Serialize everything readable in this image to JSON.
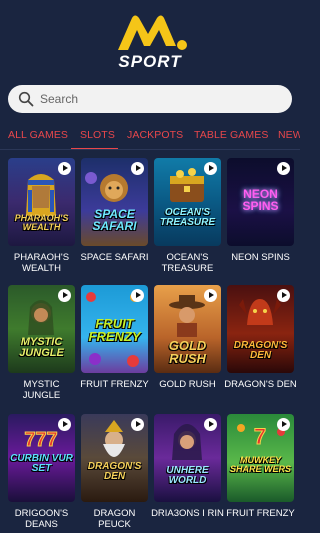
{
  "brand": {
    "sport_text": "SPORT"
  },
  "search": {
    "placeholder": "Search"
  },
  "tabs": [
    {
      "label": "ALL GAMES"
    },
    {
      "label": "SLOTS"
    },
    {
      "label": "JACKPOTS"
    },
    {
      "label": "TABLE GAMES"
    },
    {
      "label": "NEW"
    }
  ],
  "active_tab": "SLOTS",
  "colors": {
    "background": "#1a2540",
    "accent": "#e8474b",
    "logo_yellow": "#f5c518"
  },
  "games": [
    {
      "title": "PHARAOH'S WEALTH",
      "art_text": "PHARAOH'S WEALTH",
      "icon": "play-icon"
    },
    {
      "title": "SPACE SAFARI",
      "art_text": "SPACE SAFARI",
      "icon": "play-icon"
    },
    {
      "title": "OCEAN'S TREASURE",
      "art_text": "OCEAN'S TREASURE",
      "icon": "play-icon"
    },
    {
      "title": "NEON SPINS",
      "art_text": "NEON SPINS",
      "icon": "play-icon"
    },
    {
      "title": "MYSTIC JUNGLE",
      "art_text": "MYSTIC JUNGLE",
      "icon": "play-icon"
    },
    {
      "title": "FRUIT FRENZY",
      "art_text": "FRUIT FRENZY",
      "icon": "play-icon"
    },
    {
      "title": "GOLD RUSH",
      "art_text": "GOLD RUSH",
      "icon": "play-icon"
    },
    {
      "title": "DRAGON'S DEN",
      "art_text": "DRAGON'S DEN",
      "icon": "play-icon"
    },
    {
      "title": "DRIGOON'S DEANS",
      "art_text": "CURBIN VUR SET",
      "icon": "play-icon"
    },
    {
      "title": "DRAGON PEUCK",
      "art_text": "DRAGON'S DEN",
      "icon": "play-icon"
    },
    {
      "title": "DRIA3ONS I RIN",
      "art_text": "UNHERE WORLD",
      "icon": "play-icon"
    },
    {
      "title": "FRUIT FRENZY",
      "art_text": "MUWKEY SHARE WERS",
      "icon": "play-icon"
    }
  ]
}
